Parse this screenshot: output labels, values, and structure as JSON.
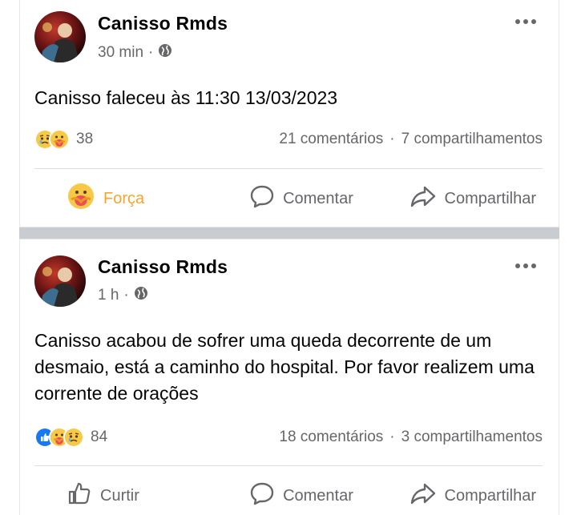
{
  "posts": [
    {
      "author": "Canisso Rmds",
      "time": "30 min",
      "text": "Canisso faleceu às 11:30 13/03/2023",
      "reaction_count": "38",
      "reaction_icons": [
        "sad-reaction-icon",
        "care-reaction-icon"
      ],
      "comments": "21 comentários",
      "shares": "7 compartilhamentos",
      "actions": {
        "react": "Força",
        "comment": "Comentar",
        "share": "Compartilhar"
      }
    },
    {
      "author": "Canisso Rmds",
      "time": "1 h",
      "text": "Canisso acabou de sofrer uma queda decorrente de um desmaio, está a caminho do hospital. Por favor realizem uma corrente de orações",
      "reaction_count": "84",
      "reaction_icons": [
        "like-reaction-icon",
        "care-reaction-icon",
        "sad-reaction-icon"
      ],
      "comments": "18 comentários",
      "shares": "3 compartilhamentos",
      "actions": {
        "react": "Curtir",
        "comment": "Comentar",
        "share": "Compartilhar"
      }
    }
  ],
  "colors": {
    "text": "#050505",
    "secondary": "#65676b",
    "like": "#1877f2",
    "care_accent": "#f2a62e",
    "divider": "#c9ccd1"
  }
}
